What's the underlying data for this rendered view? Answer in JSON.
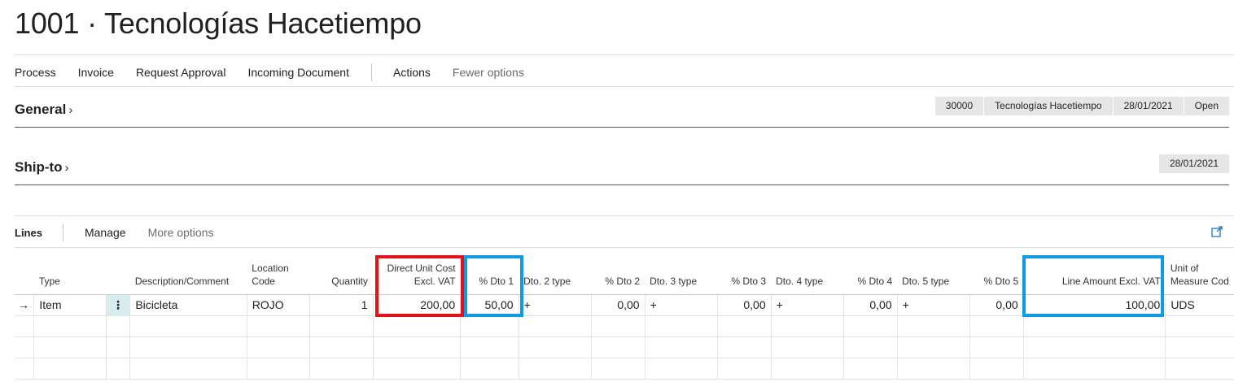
{
  "page": {
    "title": "1001 · Tecnologías Hacetiempo"
  },
  "actions": {
    "process": "Process",
    "invoice": "Invoice",
    "request_approval": "Request Approval",
    "incoming_document": "Incoming Document",
    "actions": "Actions",
    "fewer_options": "Fewer options"
  },
  "general": {
    "caption": "General",
    "summary": [
      "30000",
      "Tecnologías Hacetiempo",
      "28/01/2021",
      "Open"
    ]
  },
  "ship_to": {
    "caption": "Ship-to",
    "summary": [
      "28/01/2021"
    ]
  },
  "lines": {
    "caption": "Lines",
    "manage": "Manage",
    "more_options": "More options",
    "headers": {
      "type": "Type",
      "description": "Description/Comment",
      "location_1": "Location",
      "location_2": "Code",
      "quantity": "Quantity",
      "direct_unit_cost_1": "Direct Unit Cost",
      "direct_unit_cost_2": "Excl. VAT",
      "dto1": "% Dto 1",
      "dto2_type": "Dto. 2 type",
      "dto2": "% Dto 2",
      "dto3_type": "Dto. 3 type",
      "dto3": "% Dto 3",
      "dto4_type": "Dto. 4 type",
      "dto4": "% Dto 4",
      "dto5_type": "Dto. 5 type",
      "dto5": "% Dto 5",
      "line_amount": "Line Amount Excl. VAT",
      "uom_1": "Unit of",
      "uom_2": "Measure Cod"
    },
    "row": {
      "marker": "→",
      "type": "Item",
      "menu": "⋮",
      "description": "Bicicleta",
      "location": "ROJO",
      "quantity": "1",
      "direct_unit_cost": "200,00",
      "dto1": "50,00",
      "dto2_type": "+",
      "dto2": "0,00",
      "dto3_type": "+",
      "dto3": "0,00",
      "dto4_type": "+",
      "dto4": "0,00",
      "dto5_type": "+",
      "dto5": "0,00",
      "line_amount": "100,00",
      "uom": "UDS"
    }
  },
  "colors": {
    "highlight_red": "#e2121c",
    "highlight_blue": "#0f9be0",
    "selected_cell": "#d6ecee"
  }
}
